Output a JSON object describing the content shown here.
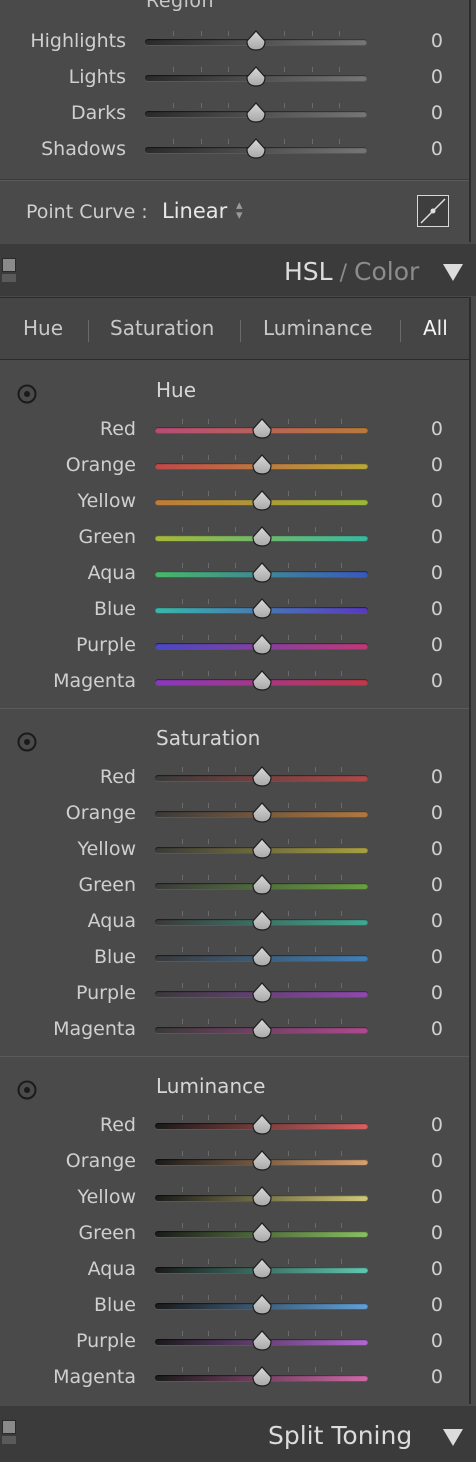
{
  "tone_curve": {
    "region_label": "Region",
    "sliders": [
      {
        "label": "Highlights",
        "value": "0"
      },
      {
        "label": "Lights",
        "value": "0"
      },
      {
        "label": "Darks",
        "value": "0"
      },
      {
        "label": "Shadows",
        "value": "0"
      }
    ],
    "point_curve_label": "Point Curve :",
    "point_curve_value": "Linear"
  },
  "hsl_panel": {
    "title_hsl": "HSL",
    "title_sep": " / ",
    "title_color": "Color",
    "tabs": [
      {
        "label": "Hue",
        "active": false
      },
      {
        "label": "Saturation",
        "active": false
      },
      {
        "label": "Luminance",
        "active": false
      },
      {
        "label": "All",
        "active": true
      }
    ],
    "sections": [
      {
        "title": "Hue",
        "sliders": [
          {
            "label": "Red",
            "value": "0",
            "left_color": "#b84a78",
            "right_color": "#b87a38"
          },
          {
            "label": "Orange",
            "value": "0",
            "left_color": "#c0484a",
            "right_color": "#b8a838"
          },
          {
            "label": "Yellow",
            "value": "0",
            "left_color": "#c07a38",
            "right_color": "#98b838"
          },
          {
            "label": "Green",
            "value": "0",
            "left_color": "#a8b838",
            "right_color": "#38b8a0"
          },
          {
            "label": "Aqua",
            "value": "0",
            "left_color": "#48b868",
            "right_color": "#3858c0"
          },
          {
            "label": "Blue",
            "value": "0",
            "left_color": "#38b8a8",
            "right_color": "#5838c0"
          },
          {
            "label": "Purple",
            "value": "0",
            "left_color": "#4848c8",
            "right_color": "#c03878"
          },
          {
            "label": "Magenta",
            "value": "0",
            "left_color": "#8838c0",
            "right_color": "#c03848"
          }
        ]
      },
      {
        "title": "Saturation",
        "sliders": [
          {
            "label": "Red",
            "value": "0",
            "left_color": "#3a3a3a",
            "right_color": "#b04848"
          },
          {
            "label": "Orange",
            "value": "0",
            "left_color": "#3a3a3a",
            "right_color": "#b07840"
          },
          {
            "label": "Yellow",
            "value": "0",
            "left_color": "#3a3a3a",
            "right_color": "#a8a040"
          },
          {
            "label": "Green",
            "value": "0",
            "left_color": "#3a3a3a",
            "right_color": "#68a040"
          },
          {
            "label": "Aqua",
            "value": "0",
            "left_color": "#3a3a3a",
            "right_color": "#40a890"
          },
          {
            "label": "Blue",
            "value": "0",
            "left_color": "#3a3a3a",
            "right_color": "#4080b8"
          },
          {
            "label": "Purple",
            "value": "0",
            "left_color": "#3a3a3a",
            "right_color": "#9048b0"
          },
          {
            "label": "Magenta",
            "value": "0",
            "left_color": "#3a3a3a",
            "right_color": "#b04890"
          }
        ]
      },
      {
        "title": "Luminance",
        "sliders": [
          {
            "label": "Red",
            "value": "0",
            "left_color": "#1a1a1a",
            "right_color": "#d86060"
          },
          {
            "label": "Orange",
            "value": "0",
            "left_color": "#1a1a1a",
            "right_color": "#d8a070"
          },
          {
            "label": "Yellow",
            "value": "0",
            "left_color": "#1a1a1a",
            "right_color": "#d0c878"
          },
          {
            "label": "Green",
            "value": "0",
            "left_color": "#1a1a1a",
            "right_color": "#88c060"
          },
          {
            "label": "Aqua",
            "value": "0",
            "left_color": "#1a1a1a",
            "right_color": "#60c8b0"
          },
          {
            "label": "Blue",
            "value": "0",
            "left_color": "#1a1a1a",
            "right_color": "#60a0d8"
          },
          {
            "label": "Purple",
            "value": "0",
            "left_color": "#1a1a1a",
            "right_color": "#b068d0"
          },
          {
            "label": "Magenta",
            "value": "0",
            "left_color": "#1a1a1a",
            "right_color": "#d068a8"
          }
        ]
      }
    ]
  },
  "split_toning": {
    "title": "Split Toning"
  }
}
